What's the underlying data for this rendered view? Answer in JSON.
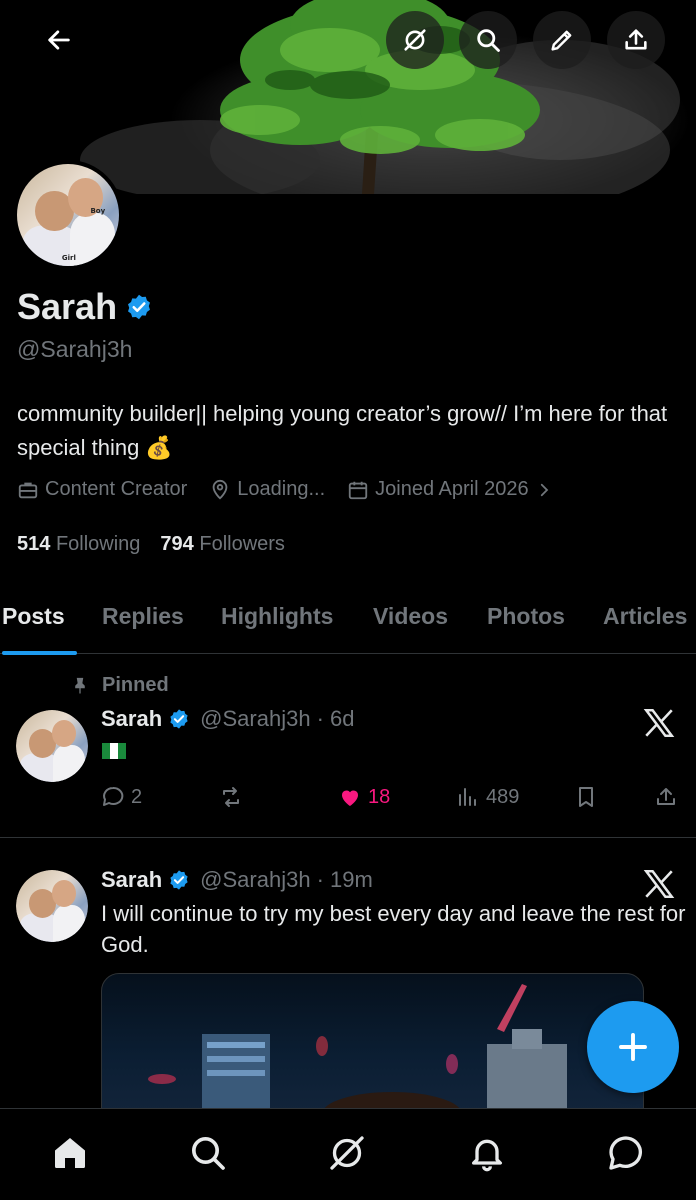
{
  "profile": {
    "name": "Sarah",
    "handle": "@Sarahj3h",
    "bio": "community builder|| helping young creator’s grow// I’m here for that special thing 💰",
    "category": "Content Creator",
    "location": "Loading...",
    "joined": "Joined April 2026",
    "following_count": "514",
    "following_label": "Following",
    "followers_count": "794",
    "followers_label": "Followers",
    "avatar_tags": {
      "boy": "Boy",
      "girl": "Girl"
    }
  },
  "tabs": [
    "Posts",
    "Replies",
    "Highlights",
    "Videos",
    "Photos",
    "Articles"
  ],
  "active_tab": "Posts",
  "posts": [
    {
      "pinned_label": "Pinned",
      "name": "Sarah",
      "handle": "@Sarahj3h",
      "time": "· 6d",
      "text": "🇳🇬",
      "replies": "2",
      "reposts": "",
      "likes": "18",
      "views": "489"
    },
    {
      "name": "Sarah",
      "handle": "@Sarahj3h",
      "time": "· 19m",
      "text": "I will continue to try my best every day and leave the rest for God."
    }
  ],
  "icons": {
    "back": "arrow-left-icon",
    "grok": "grok-icon",
    "search": "search-icon",
    "edit": "pencil-icon",
    "share": "share-icon",
    "verified": "verified-badge-icon",
    "category": "briefcase-icon",
    "location": "location-pin-icon",
    "calendar": "calendar-icon",
    "x_logo": "x-logo-icon",
    "compose": "plus-icon"
  },
  "colors": {
    "accent": "#1d9bf0",
    "like": "#f91880",
    "muted": "#71767b",
    "text": "#e7e9ea",
    "background": "#000000"
  }
}
